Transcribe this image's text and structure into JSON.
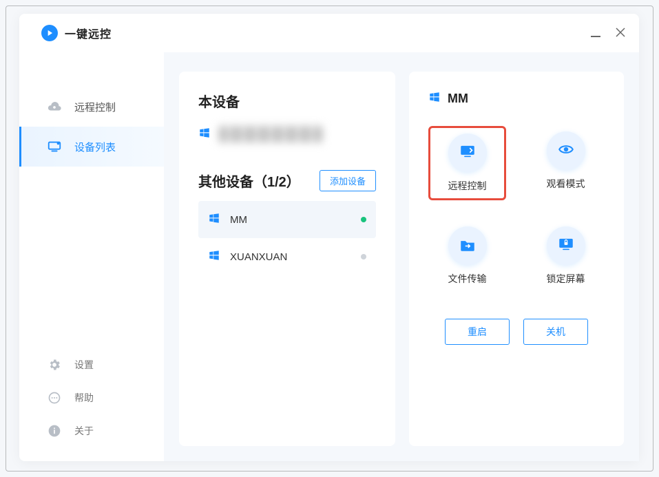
{
  "brand": {
    "title": "一键远控"
  },
  "sidebar": {
    "nav": {
      "remote_control": "远程控制",
      "device_list": "设备列表"
    },
    "bottom": {
      "settings": "设置",
      "help": "帮助",
      "about": "关于"
    }
  },
  "main": {
    "this_device_title": "本设备",
    "other_devices_title": "其他设备（1/2）",
    "add_device_label": "添加设备",
    "devices": [
      {
        "name": "MM",
        "online": true
      },
      {
        "name": "XUANXUAN",
        "online": false
      }
    ]
  },
  "detail": {
    "device_name": "MM",
    "actions": {
      "remote_control": "远程控制",
      "watch_mode": "观看模式",
      "file_transfer": "文件传输",
      "lock_screen": "锁定屏幕"
    },
    "restart": "重启",
    "shutdown": "关机"
  }
}
